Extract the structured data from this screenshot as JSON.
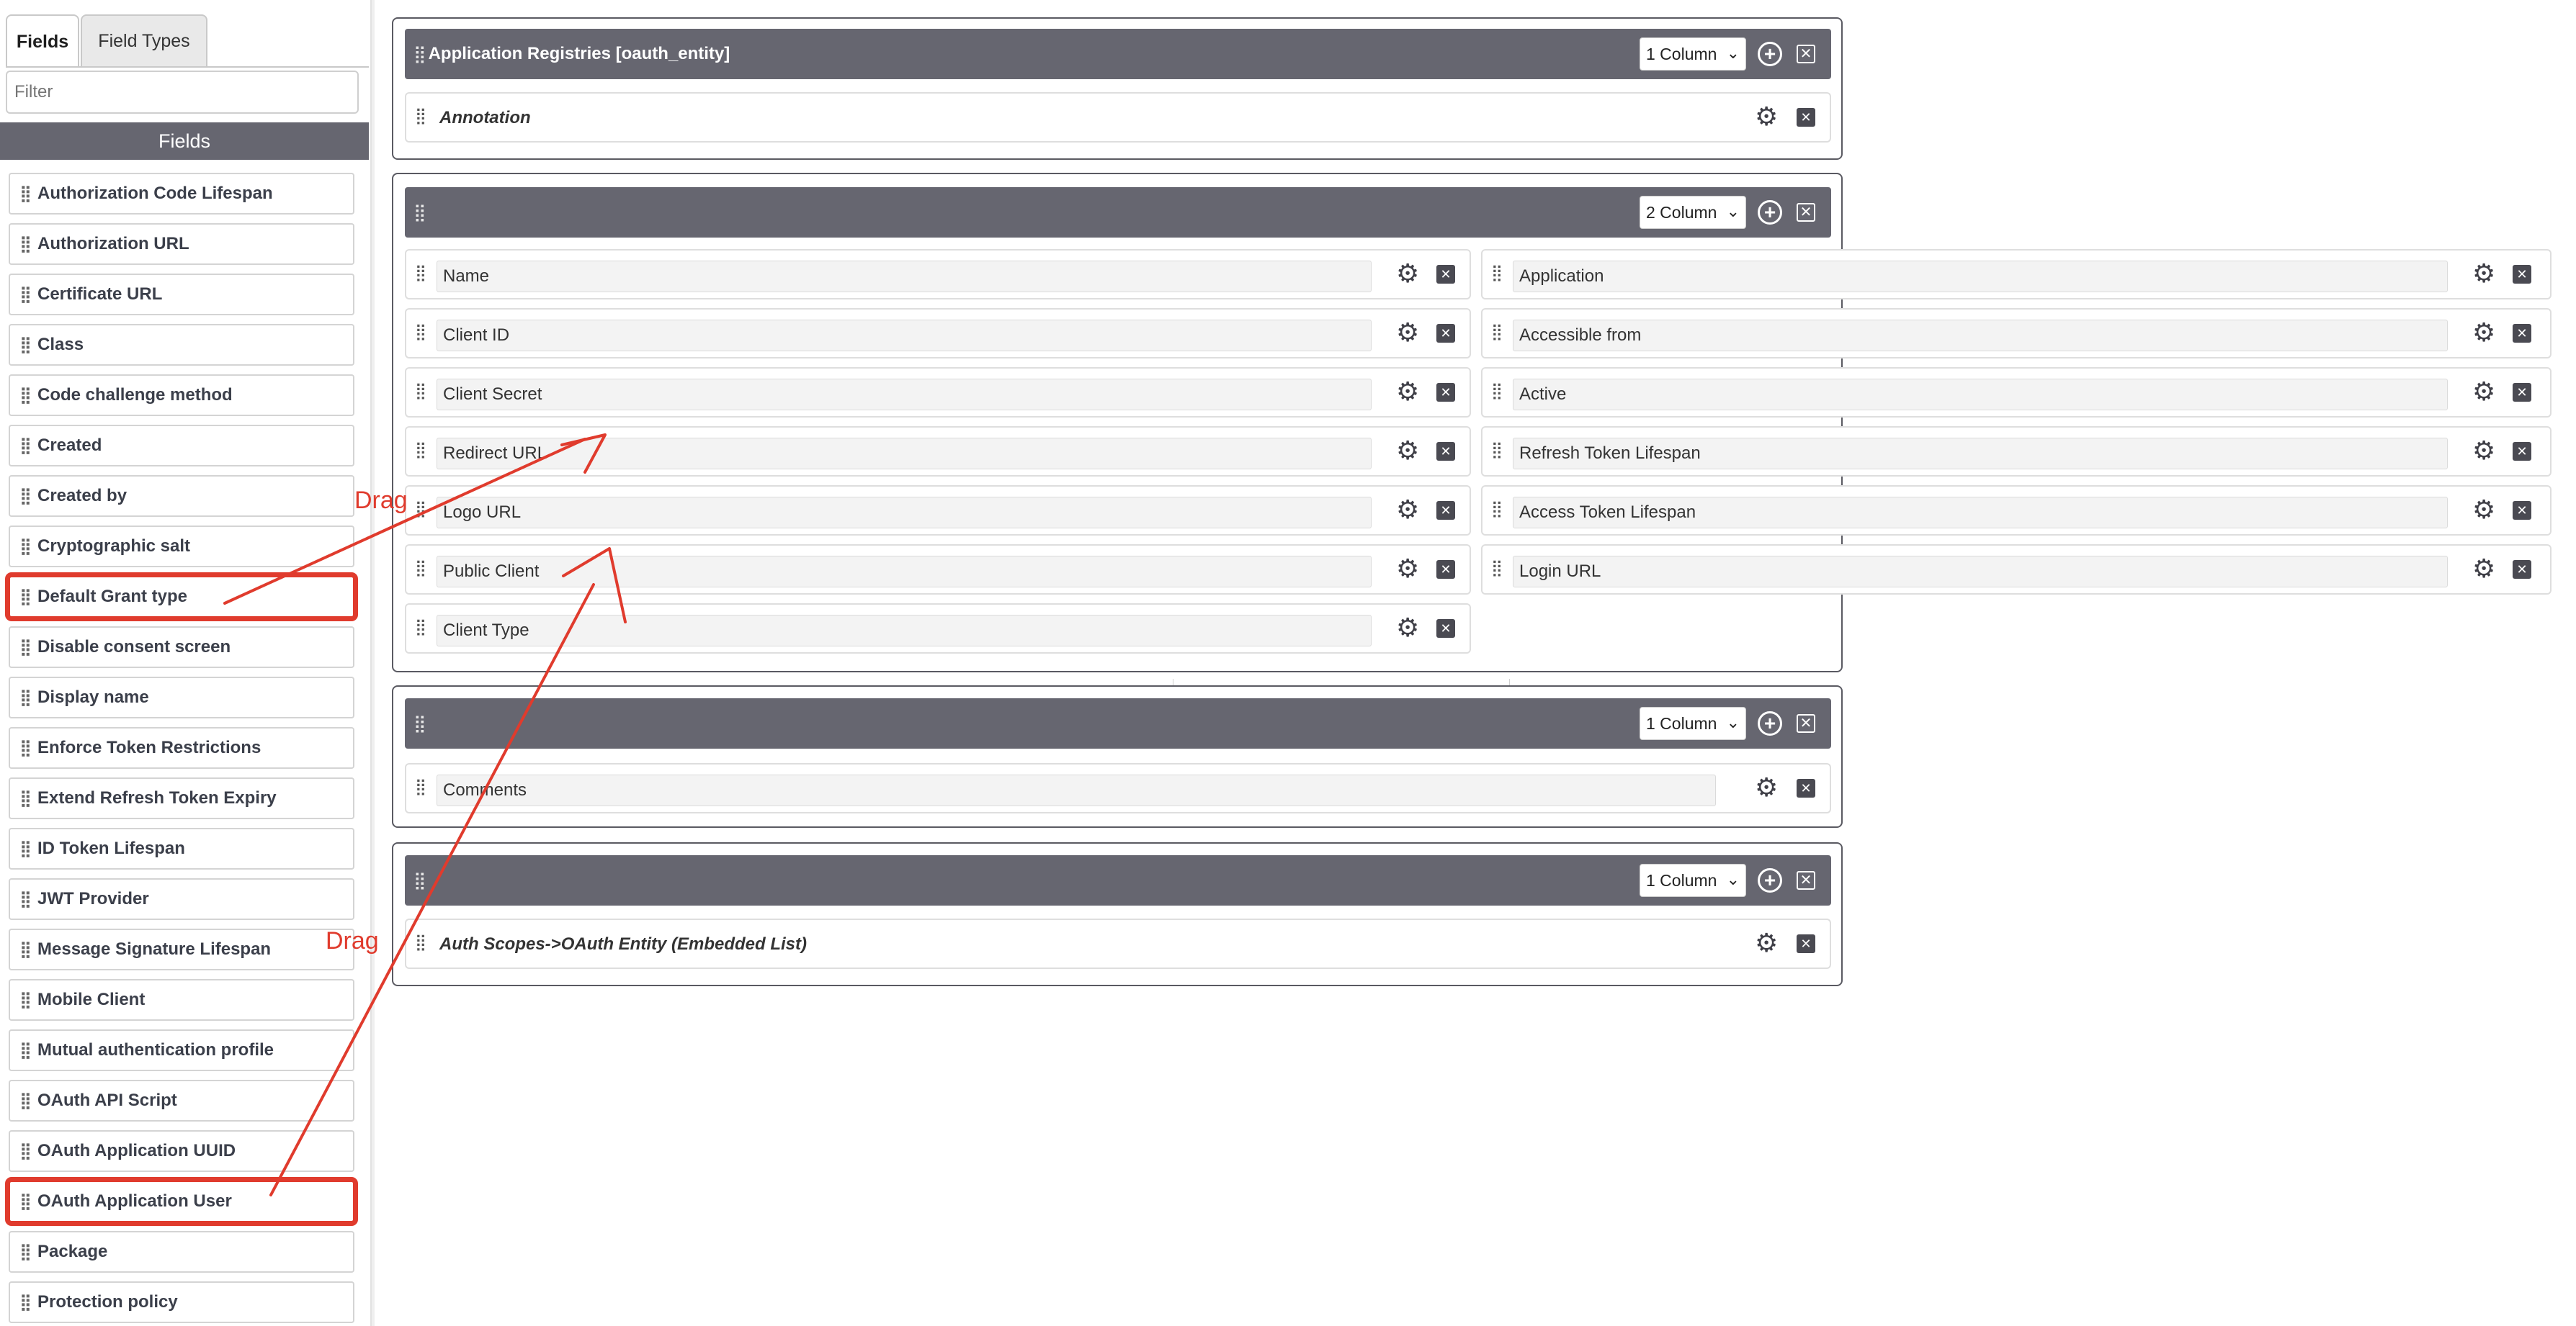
{
  "sidebar": {
    "tabs": [
      {
        "label": "Fields"
      },
      {
        "label": "Field Types"
      }
    ],
    "filter_placeholder": "Filter",
    "header": "Fields",
    "items": [
      {
        "label": "Authorization Code Lifespan"
      },
      {
        "label": "Authorization URL"
      },
      {
        "label": "Certificate URL"
      },
      {
        "label": "Class"
      },
      {
        "label": "Code challenge method"
      },
      {
        "label": "Created"
      },
      {
        "label": "Created by"
      },
      {
        "label": "Cryptographic salt"
      },
      {
        "label": "Default Grant type"
      },
      {
        "label": "Disable consent screen"
      },
      {
        "label": "Display name"
      },
      {
        "label": "Enforce Token Restrictions"
      },
      {
        "label": "Extend Refresh Token Expiry"
      },
      {
        "label": "ID Token Lifespan"
      },
      {
        "label": "JWT Provider"
      },
      {
        "label": "Message Signature Lifespan"
      },
      {
        "label": "Mobile Client"
      },
      {
        "label": "Mutual authentication profile"
      },
      {
        "label": "OAuth API Script"
      },
      {
        "label": "OAuth Application UUID"
      },
      {
        "label": "OAuth Application User"
      },
      {
        "label": "Package"
      },
      {
        "label": "Protection policy"
      }
    ]
  },
  "sections": [
    {
      "title": "Application Registries [oauth_entity]",
      "columns": "1 Column",
      "rows": [
        {
          "label": "Annotation"
        }
      ]
    },
    {
      "title": "",
      "columns": "2 Column",
      "left": [
        {
          "label": "Name"
        },
        {
          "label": "Client ID"
        },
        {
          "label": "Client Secret"
        },
        {
          "label": "Redirect URL"
        },
        {
          "label": "Logo URL"
        },
        {
          "label": "Public Client"
        },
        {
          "label": "Client Type"
        }
      ],
      "right": [
        {
          "label": "Application"
        },
        {
          "label": "Accessible from"
        },
        {
          "label": "Active"
        },
        {
          "label": "Refresh Token Lifespan"
        },
        {
          "label": "Access Token Lifespan"
        },
        {
          "label": "Login URL"
        }
      ]
    },
    {
      "title": "",
      "columns": "1 Column",
      "rows": [
        {
          "label": "Comments"
        }
      ]
    },
    {
      "title": "",
      "columns": "1 Column",
      "rows": [
        {
          "label": "Auth Scopes->OAuth Entity (Embedded List)"
        }
      ]
    }
  ],
  "annotations": {
    "drag_1": "Drag",
    "drag_2": "Drag",
    "highlighted_items": [
      "Default Grant type",
      "OAuth Application User"
    ],
    "annotation_color": "#e03b2d"
  },
  "colors": {
    "section_header": "#666670",
    "sidebar_header": "#666670"
  }
}
